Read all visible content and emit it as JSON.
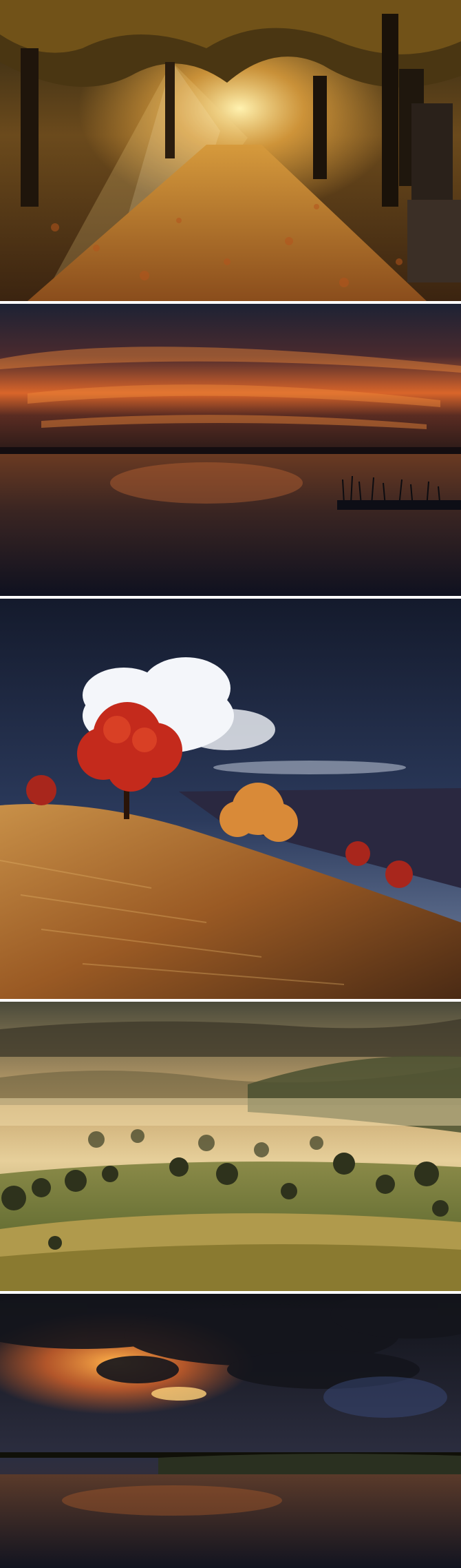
{
  "page": {
    "background": "#ffffff",
    "divider_color": "#ffffff"
  },
  "photos": [
    {
      "subject": "autumn-avenue",
      "palette": [
        "#2b1a0c",
        "#c8812c",
        "#f5d27a",
        "#3d2c12"
      ]
    },
    {
      "subject": "lake-sunset",
      "palette": [
        "#1d2032",
        "#e0652a",
        "#5a2a1c",
        "#0f1220"
      ]
    },
    {
      "subject": "hillside-red-tree",
      "palette": [
        "#1b2238",
        "#ffffff",
        "#c72a1c",
        "#b78238"
      ]
    },
    {
      "subject": "misty-valley",
      "palette": [
        "#c9a66a",
        "#6b6b3a",
        "#3a3f22",
        "#b89a54"
      ]
    },
    {
      "subject": "storm-sunset-lake",
      "palette": [
        "#161820",
        "#f08a2a",
        "#2c2d3e",
        "#1e2014"
      ]
    }
  ]
}
